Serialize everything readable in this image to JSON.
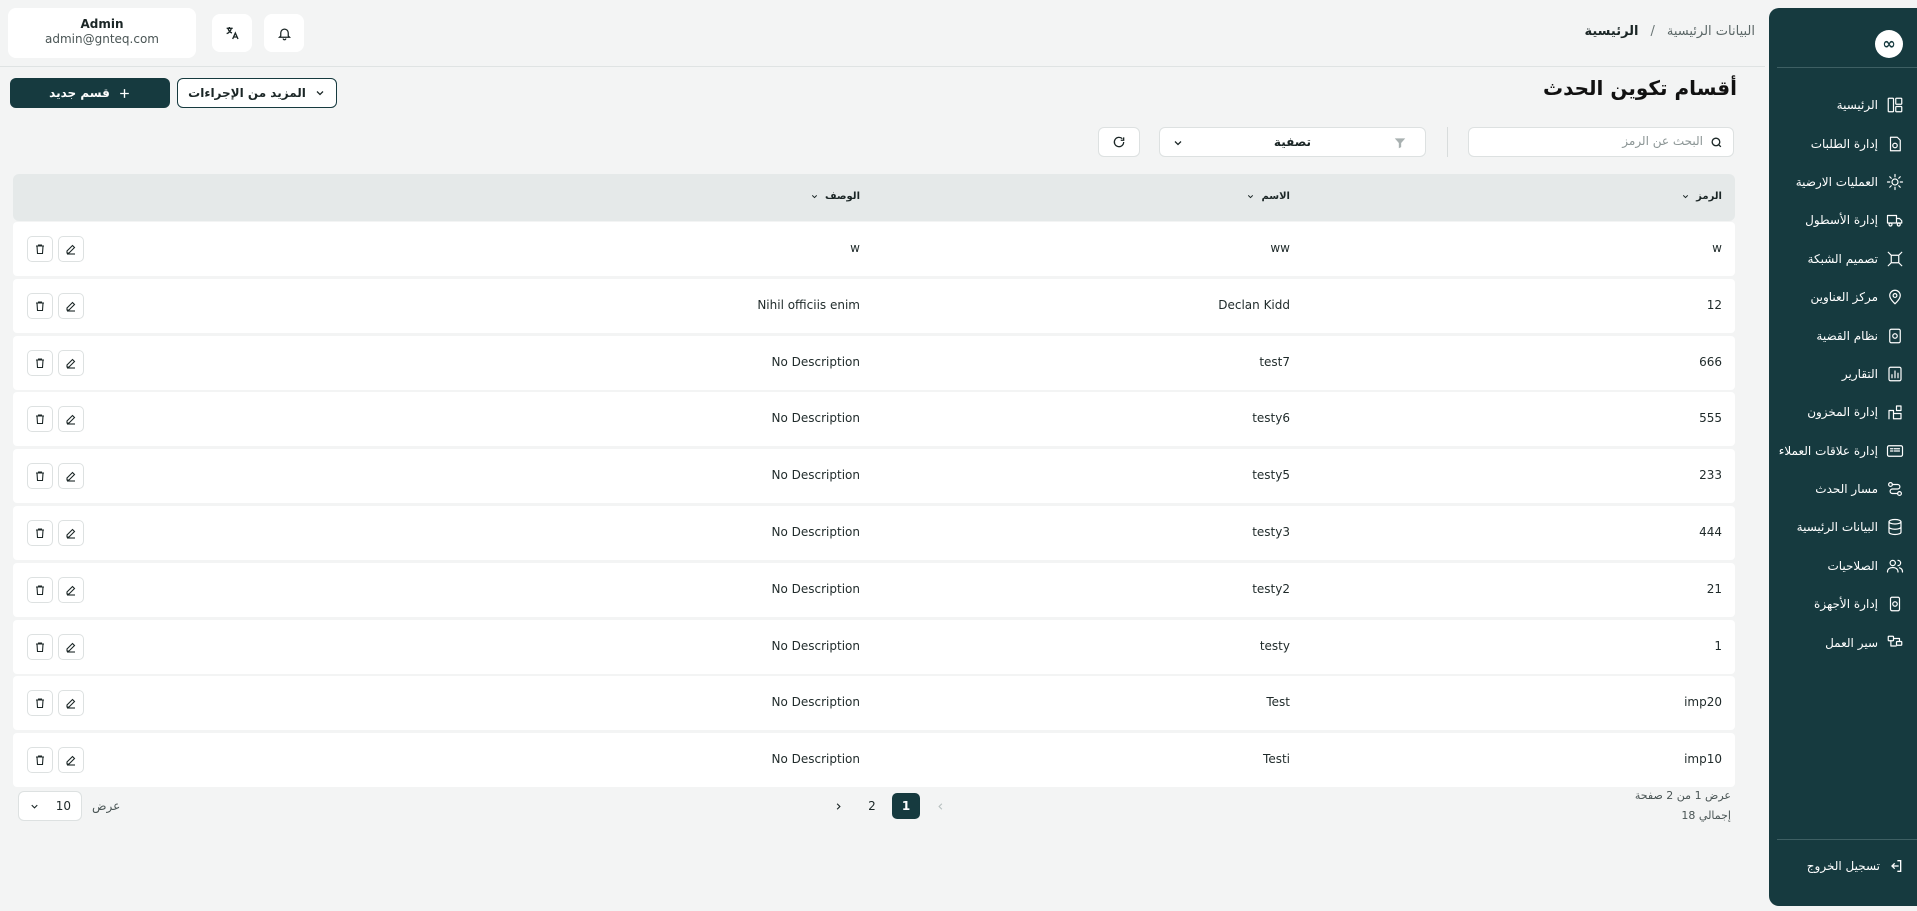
{
  "user": {
    "name": "Admin",
    "email": "admin@gnteq.com"
  },
  "breadcrumb": {
    "home": "الرئيسية",
    "separator": "/",
    "current": "البيانات الرئيسية"
  },
  "page": {
    "title": "أقسام تكوين الحدث",
    "new_button": "قسم جديد",
    "more_actions": "المزيد من الإجراءات"
  },
  "toolbar": {
    "search_placeholder": "البحث عن الرمز",
    "filter_label": "تصفية"
  },
  "sidebar": {
    "logo": "∞",
    "items": [
      {
        "label": "الرئيسية",
        "icon": "dashboard-icon"
      },
      {
        "label": "إدارة الطلبات",
        "icon": "orders-icon"
      },
      {
        "label": "العمليات الارضية",
        "icon": "ground-ops-icon"
      },
      {
        "label": "إدارة الأسطول",
        "icon": "truck-icon"
      },
      {
        "label": "تصميم الشبكة",
        "icon": "network-icon"
      },
      {
        "label": "مركز العناوين",
        "icon": "location-icon"
      },
      {
        "label": "نظام القضية",
        "icon": "case-icon"
      },
      {
        "label": "التقارير",
        "icon": "chart-icon"
      },
      {
        "label": "إدارة المخزون",
        "icon": "warehouse-icon"
      },
      {
        "label": "إدارة علاقات العملاء",
        "icon": "crm-icon"
      },
      {
        "label": "مسار الحدث",
        "icon": "route-icon"
      },
      {
        "label": "البيانات الرئيسية",
        "icon": "database-icon"
      },
      {
        "label": "الصلاحيات",
        "icon": "users-icon"
      },
      {
        "label": "إدارة الأجهزة",
        "icon": "devices-icon"
      },
      {
        "label": "سير العمل",
        "icon": "workflow-icon"
      }
    ],
    "logout": "تسجيل الخروج"
  },
  "table": {
    "headers": {
      "code": "الرمز",
      "name": "الاسم",
      "description": "الوصف"
    },
    "rows": [
      {
        "code": "w",
        "name": "ww",
        "description": "w"
      },
      {
        "code": "12",
        "name": "Declan Kidd",
        "description": "Nihil officiis enim"
      },
      {
        "code": "666",
        "name": "test7",
        "description": "No Description"
      },
      {
        "code": "555",
        "name": "testy6",
        "description": "No Description"
      },
      {
        "code": "233",
        "name": "testy5",
        "description": "No Description"
      },
      {
        "code": "444",
        "name": "testy3",
        "description": "No Description"
      },
      {
        "code": "21",
        "name": "testy2",
        "description": "No Description"
      },
      {
        "code": "1",
        "name": "testy",
        "description": "No Description"
      },
      {
        "code": "imp20",
        "name": "Test",
        "description": "No Description"
      },
      {
        "code": "imp10",
        "name": "Testi",
        "description": "No Description"
      }
    ]
  },
  "pagination": {
    "page_info": "عرض 1 من 2 صفحة",
    "total": "إجمالي 18",
    "pages": [
      "1",
      "2"
    ],
    "current": "1",
    "per_page_label": "عرض",
    "per_page_value": "10"
  },
  "colors": {
    "primary": "#163a3f",
    "background": "#f3f4f4",
    "header_row": "#e5e9e9"
  }
}
